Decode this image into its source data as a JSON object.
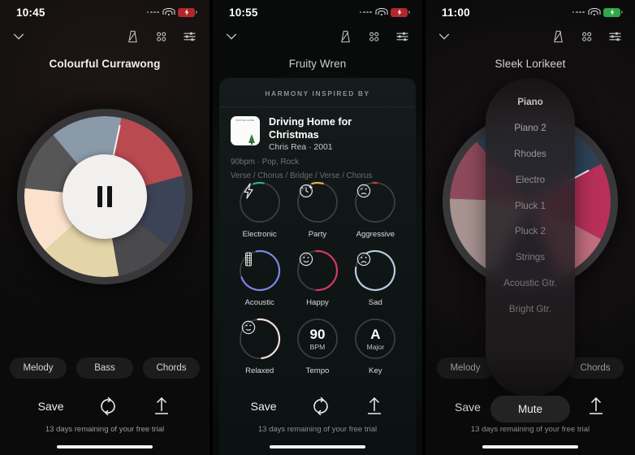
{
  "panels": [
    {
      "status": {
        "time": "10:45",
        "signal_icon": "signal-dots-icon",
        "wifi_icon": "wifi-icon",
        "battery_icon": "battery-charging-icon",
        "battery_color": "#b2272c"
      },
      "nav": {
        "collapse_icon": "chevron-down-icon",
        "metronome_icon": "metronome-icon",
        "grid_icon": "grid-dots-icon",
        "mixer_icon": "mixer-sliders-icon"
      },
      "title": "Colourful Currawong",
      "wheel": {
        "needle_angle": 12,
        "center_icon": "pause-icon",
        "segments": [
          {
            "name": "red",
            "color": "#b94a50",
            "start": 12,
            "end": 75
          },
          {
            "name": "navy",
            "color": "#3d4357",
            "start": 75,
            "end": 128
          },
          {
            "name": "dark-grey",
            "color": "#4a4a4c",
            "start": 128,
            "end": 170
          },
          {
            "name": "cream",
            "color": "#e4d5a8",
            "start": 170,
            "end": 228
          },
          {
            "name": "peach",
            "color": "#fbe2cd",
            "start": 228,
            "end": 276
          },
          {
            "name": "charcoal",
            "color": "#565656",
            "start": 276,
            "end": 320
          },
          {
            "name": "steel-blue",
            "color": "#8b9aa8",
            "start": 320,
            "end": 12
          }
        ]
      },
      "pills": [
        "Melody",
        "Bass",
        "Chords"
      ],
      "transport": {
        "save_label": "Save",
        "refresh_icon": "refresh-icon",
        "export_icon": "export-up-icon"
      },
      "trial": "13 days remaining of your free trial"
    },
    {
      "status": {
        "time": "10:55",
        "signal_icon": "signal-dots-icon",
        "wifi_icon": "wifi-icon",
        "battery_icon": "battery-charging-icon",
        "battery_color": "#b2272c"
      },
      "nav": {
        "collapse_icon": "chevron-down-icon",
        "metronome_icon": "metronome-icon",
        "grid_icon": "grid-dots-icon",
        "mixer_icon": "mixer-sliders-icon"
      },
      "title": "Fruity Wren",
      "card": {
        "header": "HARMONY INSPIRED BY",
        "album_art_icon": "album-art-christmas-tree",
        "song_title": "Driving Home for Christmas",
        "artist_year": "Chris Rea · 2001",
        "tempo_genre": "90bpm · Pop, Rock",
        "structure": "Verse / Chorus / Bridge / Verse / Chorus"
      },
      "dials": [
        {
          "label": "Electronic",
          "icon": "lightning-bolt-icon",
          "arc_pct": 8,
          "arc_start": -18,
          "arc_color": "#2faf86"
        },
        {
          "label": "Party",
          "icon": "sparkle-clock-icon",
          "arc_pct": 9,
          "arc_start": -16,
          "arc_color": "#e0b544"
        },
        {
          "label": "Aggressive",
          "icon": "angry-face-icon",
          "arc_pct": 3,
          "arc_start": -6,
          "arc_color": "#d13a3a"
        },
        {
          "label": "Acoustic",
          "icon": "guitar-neck-icon",
          "arc_pct": 72,
          "arc_start": -10,
          "arc_color": "#7b85e6"
        },
        {
          "label": "Happy",
          "icon": "smile-face-icon",
          "arc_pct": 52,
          "arc_start": -4,
          "arc_color": "#cf3a63"
        },
        {
          "label": "Sad",
          "icon": "sad-face-icon",
          "arc_pct": 84,
          "arc_start": -24,
          "arc_color": "#b6ccdd"
        },
        {
          "label": "Relaxed",
          "icon": "content-face-icon",
          "arc_pct": 50,
          "arc_start": -6,
          "arc_color": "#f3ddd4"
        },
        {
          "label": "Tempo",
          "value": "90",
          "unit": "BPM",
          "arc_pct": 0,
          "arc_start": 0,
          "arc_color": "#555555"
        },
        {
          "label": "Key",
          "value": "A",
          "unit": "Major",
          "arc_pct": 0,
          "arc_start": 0,
          "arc_color": "#555555"
        }
      ],
      "transport": {
        "save_label": "Save",
        "refresh_icon": "refresh-icon",
        "export_icon": "export-up-icon"
      },
      "trial": "13 days remaining of your free trial"
    },
    {
      "status": {
        "time": "11:00",
        "signal_icon": "signal-dots-icon",
        "wifi_icon": "wifi-icon",
        "battery_icon": "battery-charging-icon",
        "battery_color": "#2fa84b"
      },
      "nav": {
        "collapse_icon": "chevron-down-icon",
        "metronome_icon": "metronome-icon",
        "grid_icon": "grid-dots-icon",
        "mixer_icon": "mixer-sliders-icon"
      },
      "title": "Sleek Lorikeet",
      "instrument_list": {
        "selected": "Piano",
        "options": [
          "Piano",
          "Piano 2",
          "Rhodes",
          "Electro",
          "Pluck 1",
          "Pluck 2",
          "Strings",
          "Acoustic Gtr.",
          "Bright Gtr."
        ]
      },
      "wheel": {
        "needle_angle": 62,
        "segments": [
          {
            "name": "crimson-pink",
            "color": "#b8305a",
            "start": 62,
            "end": 118
          },
          {
            "name": "rose",
            "color": "#c2707f",
            "start": 118,
            "end": 160
          },
          {
            "name": "deep-navy",
            "color": "#1d2042",
            "start": 160,
            "end": 206
          },
          {
            "name": "taupe-mauve",
            "color": "#a89391",
            "start": 206,
            "end": 272
          },
          {
            "name": "mauve-red",
            "color": "#8e4a5c",
            "start": 272,
            "end": 318
          },
          {
            "name": "slate-blue",
            "color": "#2d4258",
            "start": 318,
            "end": 62
          }
        ]
      },
      "pills": [
        "Melody",
        "Chords"
      ],
      "transport": {
        "save_label": "Save",
        "mute_label": "Mute",
        "export_icon": "export-up-icon"
      },
      "trial": "13 days remaining of your free trial"
    }
  ]
}
